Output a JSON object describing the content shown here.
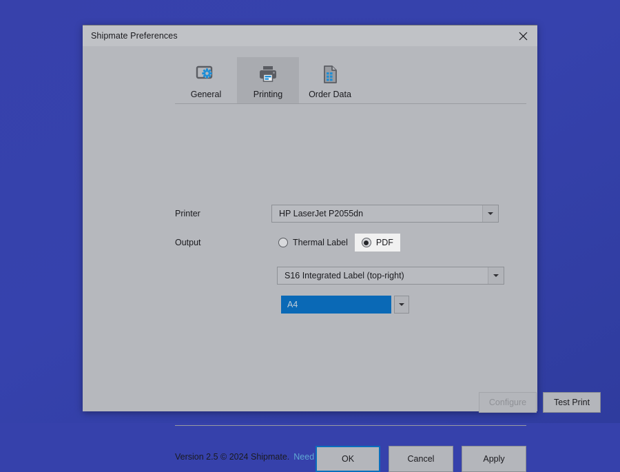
{
  "window": {
    "title": "Shipmate Preferences",
    "close_icon": "close-icon"
  },
  "tabs": [
    {
      "label": "General",
      "icon": "window-settings-icon",
      "active": false
    },
    {
      "label": "Printing",
      "icon": "printer-icon",
      "active": true
    },
    {
      "label": "Order Data",
      "icon": "document-grid-icon",
      "active": false
    }
  ],
  "form": {
    "printer": {
      "label": "Printer",
      "value": "HP LaserJet P2055dn"
    },
    "output": {
      "label": "Output",
      "options": [
        {
          "label": "Thermal Label",
          "selected": false
        },
        {
          "label": "PDF",
          "selected": true
        }
      ]
    },
    "label_format": {
      "value": "S16 Integrated Label (top-right)"
    },
    "paper_size": {
      "value": "A4"
    }
  },
  "actions": {
    "configure": "Configure",
    "test_print": "Test Print"
  },
  "footer": {
    "version_text": "Version 2.5 © 2024 Shipmate.",
    "help_link": "Need help?"
  },
  "dialog_buttons": {
    "ok": "OK",
    "cancel": "Cancel",
    "apply": "Apply"
  },
  "colors": {
    "desktop": "#3641ab",
    "dialog": "#b6b8bd",
    "titlebar": "#c0c2c6",
    "accent_blue": "#0a69b6",
    "icon_blue": "#1e8ed6",
    "link_blue": "#5fa8d3",
    "focus_border": "#0a6ebd"
  }
}
